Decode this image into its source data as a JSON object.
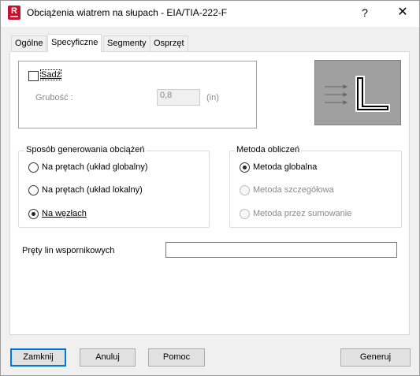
{
  "window": {
    "title": "Obciążenia wiatrem na słupach - EIA/TIA-222-F",
    "app_icon_letter": "R",
    "help_glyph": "?",
    "close_glyph": "✕"
  },
  "tabs": [
    {
      "label": "Ogólne",
      "active": false
    },
    {
      "label": "Specyficzne",
      "active": true
    },
    {
      "label": "Segmenty",
      "active": false
    },
    {
      "label": "Osprzęt",
      "active": false
    }
  ],
  "ice": {
    "checkbox_label": "Sadź",
    "checked": false,
    "thickness_label": "Grubość :",
    "thickness_value": "0,8",
    "thickness_unit": "(in)"
  },
  "load_generation": {
    "title": "Sposób generowania obciążeń",
    "options": [
      {
        "label": "Na prętach (układ globalny)",
        "selected": false
      },
      {
        "label": "Na prętach (układ lokalny)",
        "selected": false
      },
      {
        "label": "Na węzłach",
        "selected": true
      }
    ]
  },
  "calc_method": {
    "title": "Metoda obliczeń",
    "options": [
      {
        "label": "Metoda globalna",
        "selected": true,
        "enabled": true
      },
      {
        "label": "Metoda szczegółowa",
        "selected": false,
        "enabled": false
      },
      {
        "label": "Metoda przez sumowanie",
        "selected": false,
        "enabled": false
      }
    ]
  },
  "antenna_bars": {
    "label": "Pręty lin wspornikowych",
    "value": ""
  },
  "buttons": {
    "close": "Zamknij",
    "cancel": "Anuluj",
    "help": "Pomoc",
    "generate": "Generuj"
  },
  "colors": {
    "accent": "#0078d7",
    "app_icon": "#c8102e",
    "preview_bg": "#a0a0a0"
  }
}
